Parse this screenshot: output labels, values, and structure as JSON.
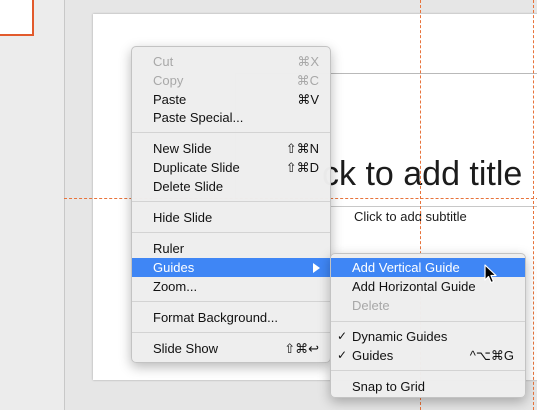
{
  "slide": {
    "title_placeholder": "ck to add title",
    "subtitle_placeholder": "Click to add subtitle"
  },
  "context_menu": {
    "cut": {
      "label": "Cut",
      "shortcut": "⌘X"
    },
    "copy": {
      "label": "Copy",
      "shortcut": "⌘C"
    },
    "paste": {
      "label": "Paste",
      "shortcut": "⌘V"
    },
    "paste_special": {
      "label": "Paste Special..."
    },
    "new_slide": {
      "label": "New Slide",
      "shortcut": "⇧⌘N"
    },
    "duplicate_slide": {
      "label": "Duplicate Slide",
      "shortcut": "⇧⌘D"
    },
    "delete_slide": {
      "label": "Delete Slide"
    },
    "hide_slide": {
      "label": "Hide Slide"
    },
    "ruler": {
      "label": "Ruler"
    },
    "guides": {
      "label": "Guides"
    },
    "zoom": {
      "label": "Zoom..."
    },
    "format_background": {
      "label": "Format Background..."
    },
    "slide_show": {
      "label": "Slide Show",
      "shortcut": "⇧⌘↩"
    }
  },
  "guides_submenu": {
    "add_vertical": {
      "label": "Add Vertical Guide"
    },
    "add_horizontal": {
      "label": "Add Horizontal Guide"
    },
    "delete": {
      "label": "Delete"
    },
    "dynamic_guides": {
      "label": "Dynamic Guides",
      "check": "✓"
    },
    "guides": {
      "label": "Guides",
      "check": "✓",
      "shortcut": "^⌥⌘G"
    },
    "snap_to_grid": {
      "label": "Snap to Grid"
    }
  },
  "colors": {
    "highlight": "#3f86f5",
    "guide": "#e8733b",
    "selected_thumbnail": "#e25a2c"
  }
}
